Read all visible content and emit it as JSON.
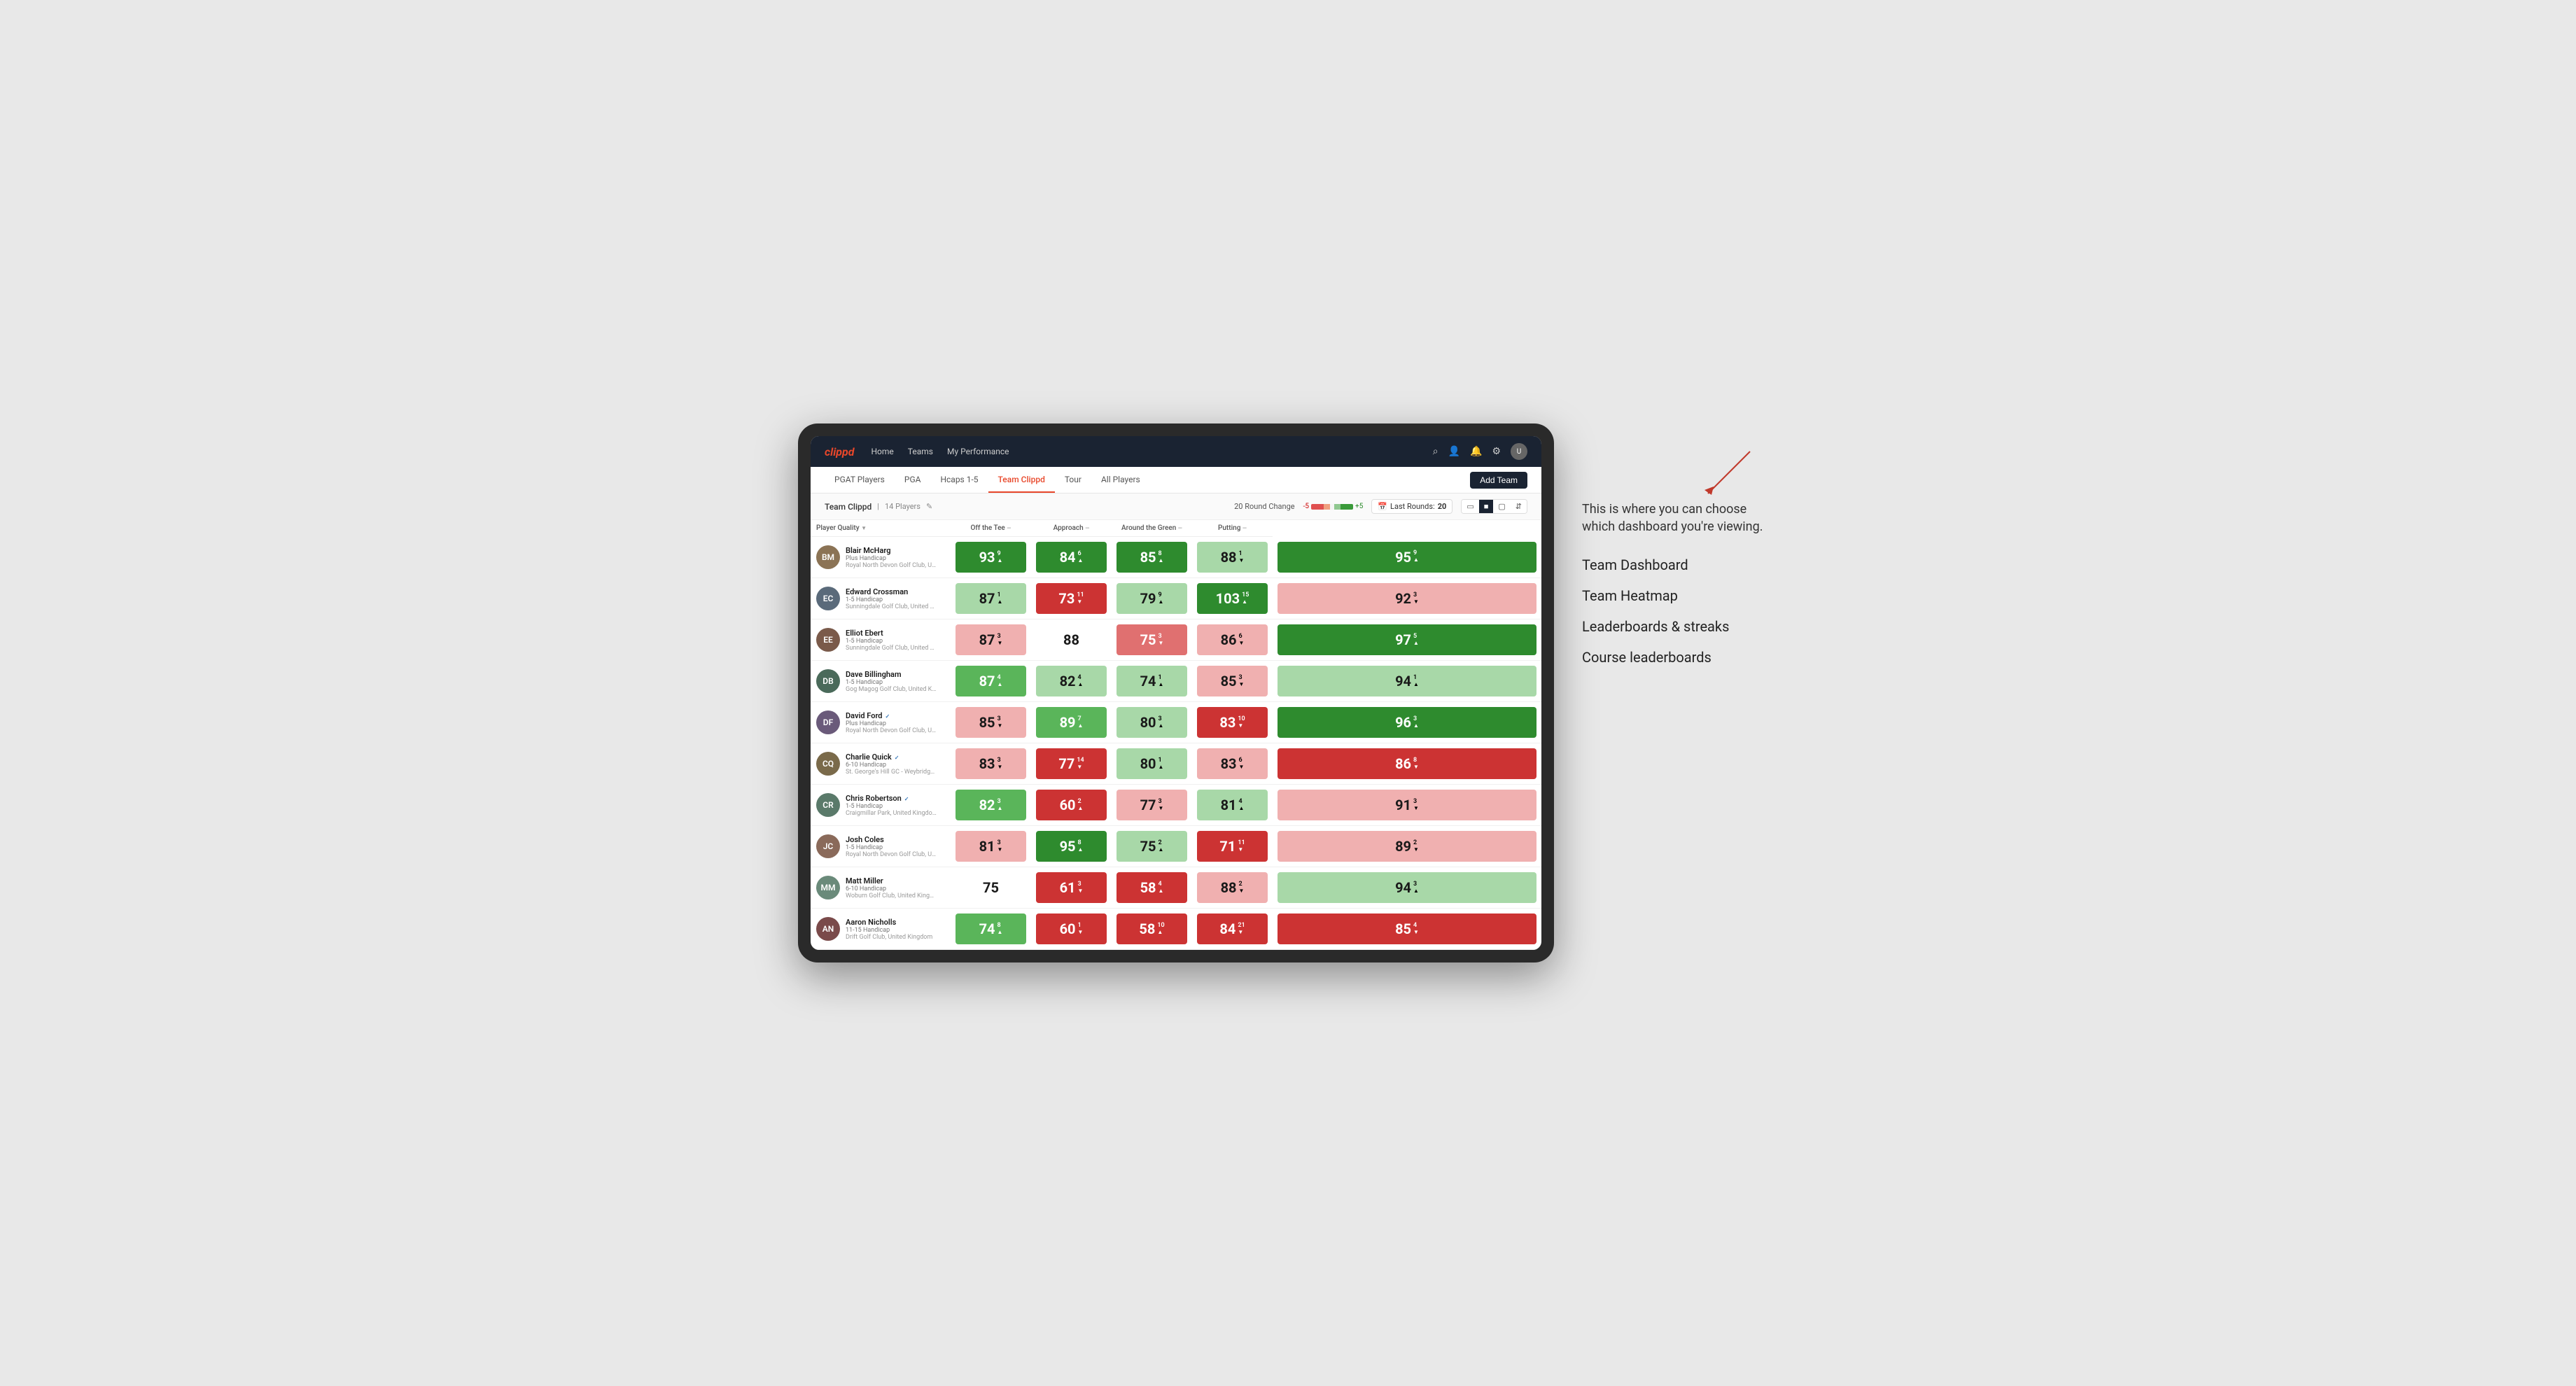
{
  "annotation": {
    "intro": "This is where you can choose which dashboard you're viewing.",
    "options": [
      "Team Dashboard",
      "Team Heatmap",
      "Leaderboards & streaks",
      "Course leaderboards"
    ]
  },
  "nav": {
    "logo": "clippd",
    "items": [
      "Home",
      "Teams",
      "My Performance"
    ],
    "icons": [
      "search",
      "person",
      "bell",
      "settings",
      "avatar"
    ]
  },
  "subNav": {
    "items": [
      "PGAT Players",
      "PGA",
      "Hcaps 1-5",
      "Team Clippd",
      "Tour",
      "All Players"
    ],
    "active": "Team Clippd",
    "addTeamLabel": "Add Team"
  },
  "teamBar": {
    "name": "Team Clippd",
    "separator": "|",
    "count": "14 Players",
    "roundChangeLabel": "20 Round Change",
    "negValue": "-5",
    "posValue": "+5",
    "lastRoundsLabel": "Last Rounds:",
    "lastRoundsValue": "20"
  },
  "tableHeaders": {
    "playerQuality": "Player Quality",
    "offTee": "Off the Tee",
    "approach": "Approach",
    "aroundGreen": "Around the Green",
    "putting": "Putting"
  },
  "players": [
    {
      "name": "Blair McHarg",
      "handicap": "Plus Handicap",
      "club": "Royal North Devon Golf Club, United Kingdom",
      "avatar_color": "#8B7355",
      "initials": "BM",
      "scores": {
        "playerQuality": {
          "value": 93,
          "change": 9,
          "dir": "up",
          "bg": "bg-green-strong"
        },
        "offTee": {
          "value": 84,
          "change": 6,
          "dir": "up",
          "bg": "bg-green-strong"
        },
        "approach": {
          "value": 85,
          "change": 8,
          "dir": "up",
          "bg": "bg-green-strong"
        },
        "aroundGreen": {
          "value": 88,
          "change": 1,
          "dir": "down",
          "bg": "bg-green-light"
        },
        "putting": {
          "value": 95,
          "change": 9,
          "dir": "up",
          "bg": "bg-green-strong"
        }
      }
    },
    {
      "name": "Edward Crossman",
      "handicap": "1-5 Handicap",
      "club": "Sunningdale Golf Club, United Kingdom",
      "avatar_color": "#5a6a7a",
      "initials": "EC",
      "scores": {
        "playerQuality": {
          "value": 87,
          "change": 1,
          "dir": "up",
          "bg": "bg-green-light"
        },
        "offTee": {
          "value": 73,
          "change": 11,
          "dir": "down",
          "bg": "bg-red-strong"
        },
        "approach": {
          "value": 79,
          "change": 9,
          "dir": "up",
          "bg": "bg-green-light"
        },
        "aroundGreen": {
          "value": 103,
          "change": 15,
          "dir": "up",
          "bg": "bg-green-strong"
        },
        "putting": {
          "value": 92,
          "change": 3,
          "dir": "down",
          "bg": "bg-red-light"
        }
      }
    },
    {
      "name": "Elliot Ebert",
      "handicap": "1-5 Handicap",
      "club": "Sunningdale Golf Club, United Kingdom",
      "avatar_color": "#7a5a4a",
      "initials": "EE",
      "scores": {
        "playerQuality": {
          "value": 87,
          "change": 3,
          "dir": "down",
          "bg": "bg-red-light"
        },
        "offTee": {
          "value": 88,
          "change": null,
          "dir": null,
          "bg": "bg-white"
        },
        "approach": {
          "value": 75,
          "change": 3,
          "dir": "down",
          "bg": "bg-red-med"
        },
        "aroundGreen": {
          "value": 86,
          "change": 6,
          "dir": "down",
          "bg": "bg-red-light"
        },
        "putting": {
          "value": 97,
          "change": 5,
          "dir": "up",
          "bg": "bg-green-strong"
        }
      }
    },
    {
      "name": "Dave Billingham",
      "handicap": "1-5 Handicap",
      "club": "Gog Magog Golf Club, United Kingdom",
      "avatar_color": "#4a6a5a",
      "initials": "DB",
      "scores": {
        "playerQuality": {
          "value": 87,
          "change": 4,
          "dir": "up",
          "bg": "bg-green-med"
        },
        "offTee": {
          "value": 82,
          "change": 4,
          "dir": "up",
          "bg": "bg-green-light"
        },
        "approach": {
          "value": 74,
          "change": 1,
          "dir": "up",
          "bg": "bg-green-light"
        },
        "aroundGreen": {
          "value": 85,
          "change": 3,
          "dir": "down",
          "bg": "bg-red-light"
        },
        "putting": {
          "value": 94,
          "change": 1,
          "dir": "up",
          "bg": "bg-green-light"
        }
      }
    },
    {
      "name": "David Ford",
      "handicap": "Plus Handicap",
      "club": "Royal North Devon Golf Club, United Kingdom",
      "avatar_color": "#6a5a7a",
      "initials": "DF",
      "verified": true,
      "scores": {
        "playerQuality": {
          "value": 85,
          "change": 3,
          "dir": "down",
          "bg": "bg-red-light"
        },
        "offTee": {
          "value": 89,
          "change": 7,
          "dir": "up",
          "bg": "bg-green-med"
        },
        "approach": {
          "value": 80,
          "change": 3,
          "dir": "up",
          "bg": "bg-green-light"
        },
        "aroundGreen": {
          "value": 83,
          "change": 10,
          "dir": "down",
          "bg": "bg-red-strong"
        },
        "putting": {
          "value": 96,
          "change": 3,
          "dir": "up",
          "bg": "bg-green-strong"
        }
      }
    },
    {
      "name": "Charlie Quick",
      "handicap": "6-10 Handicap",
      "club": "St. George's Hill GC - Weybridge, Surrey, Uni...",
      "avatar_color": "#7a6a4a",
      "initials": "CQ",
      "verified": true,
      "scores": {
        "playerQuality": {
          "value": 83,
          "change": 3,
          "dir": "down",
          "bg": "bg-red-light"
        },
        "offTee": {
          "value": 77,
          "change": 14,
          "dir": "down",
          "bg": "bg-red-strong"
        },
        "approach": {
          "value": 80,
          "change": 1,
          "dir": "up",
          "bg": "bg-green-light"
        },
        "aroundGreen": {
          "value": 83,
          "change": 6,
          "dir": "down",
          "bg": "bg-red-light"
        },
        "putting": {
          "value": 86,
          "change": 8,
          "dir": "down",
          "bg": "bg-red-strong"
        }
      }
    },
    {
      "name": "Chris Robertson",
      "handicap": "1-5 Handicap",
      "club": "Craigmillar Park, United Kingdom",
      "avatar_color": "#5a7a6a",
      "initials": "CR",
      "verified": true,
      "scores": {
        "playerQuality": {
          "value": 82,
          "change": 3,
          "dir": "up",
          "bg": "bg-green-med"
        },
        "offTee": {
          "value": 60,
          "change": 2,
          "dir": "up",
          "bg": "bg-red-strong"
        },
        "approach": {
          "value": 77,
          "change": 3,
          "dir": "down",
          "bg": "bg-red-light"
        },
        "aroundGreen": {
          "value": 81,
          "change": 4,
          "dir": "up",
          "bg": "bg-green-light"
        },
        "putting": {
          "value": 91,
          "change": 3,
          "dir": "down",
          "bg": "bg-red-light"
        }
      }
    },
    {
      "name": "Josh Coles",
      "handicap": "1-5 Handicap",
      "club": "Royal North Devon Golf Club, United Kingdom",
      "avatar_color": "#8a6a5a",
      "initials": "JC",
      "scores": {
        "playerQuality": {
          "value": 81,
          "change": 3,
          "dir": "down",
          "bg": "bg-red-light"
        },
        "offTee": {
          "value": 95,
          "change": 8,
          "dir": "up",
          "bg": "bg-green-strong"
        },
        "approach": {
          "value": 75,
          "change": 2,
          "dir": "up",
          "bg": "bg-green-light"
        },
        "aroundGreen": {
          "value": 71,
          "change": 11,
          "dir": "down",
          "bg": "bg-red-strong"
        },
        "putting": {
          "value": 89,
          "change": 2,
          "dir": "down",
          "bg": "bg-red-light"
        }
      }
    },
    {
      "name": "Matt Miller",
      "handicap": "6-10 Handicap",
      "club": "Woburn Golf Club, United Kingdom",
      "avatar_color": "#6a8a7a",
      "initials": "MM",
      "scores": {
        "playerQuality": {
          "value": 75,
          "change": null,
          "dir": null,
          "bg": "bg-white"
        },
        "offTee": {
          "value": 61,
          "change": 3,
          "dir": "down",
          "bg": "bg-red-strong"
        },
        "approach": {
          "value": 58,
          "change": 4,
          "dir": "up",
          "bg": "bg-red-strong"
        },
        "aroundGreen": {
          "value": 88,
          "change": 2,
          "dir": "down",
          "bg": "bg-red-light"
        },
        "putting": {
          "value": 94,
          "change": 3,
          "dir": "up",
          "bg": "bg-green-light"
        }
      }
    },
    {
      "name": "Aaron Nicholls",
      "handicap": "11-15 Handicap",
      "club": "Drift Golf Club, United Kingdom",
      "avatar_color": "#7a4a4a",
      "initials": "AN",
      "scores": {
        "playerQuality": {
          "value": 74,
          "change": 8,
          "dir": "up",
          "bg": "bg-green-med"
        },
        "offTee": {
          "value": 60,
          "change": 1,
          "dir": "down",
          "bg": "bg-red-strong"
        },
        "approach": {
          "value": 58,
          "change": 10,
          "dir": "up",
          "bg": "bg-red-strong"
        },
        "aroundGreen": {
          "value": 84,
          "change": 21,
          "dir": "down",
          "bg": "bg-red-strong"
        },
        "putting": {
          "value": 85,
          "change": 4,
          "dir": "down",
          "bg": "bg-red-strong"
        }
      }
    }
  ]
}
